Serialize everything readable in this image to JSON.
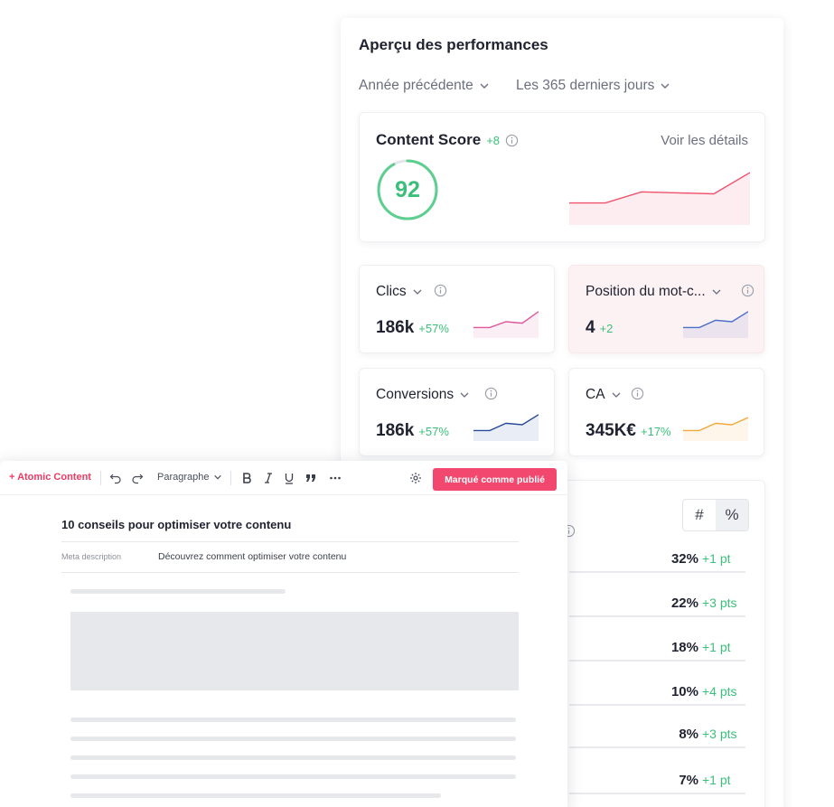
{
  "performance": {
    "title": "Aperçu des performances",
    "period_compare": "Année précédente",
    "period_range": "Les 365 derniers jours",
    "content_score": {
      "label": "Content Score",
      "delta": "+8",
      "value": "92",
      "ring_fraction": 0.92,
      "details_link": "Voir les détails",
      "trend": [
        0.4,
        0.4,
        0.62,
        0.6,
        0.58,
        1.0
      ],
      "color": "#f0526b"
    },
    "metrics": {
      "clics": {
        "label": "Clics",
        "value": "186k",
        "delta": "+57%",
        "trend": [
          0.3,
          0.3,
          0.5,
          0.45,
          0.85
        ],
        "color": "#e0579a"
      },
      "position": {
        "label": "Position du mot-c...",
        "value": "4",
        "delta": "+2",
        "trend": [
          0.3,
          0.3,
          0.55,
          0.5,
          0.85
        ],
        "color": "#4a6fc9"
      },
      "conversions": {
        "label": "Conversions",
        "value": "186k",
        "delta": "+57%",
        "trend": [
          0.3,
          0.3,
          0.55,
          0.5,
          0.85
        ],
        "color": "#2a4a9a"
      },
      "ca": {
        "label": "CA",
        "value": "345K€",
        "delta": "+17%",
        "trend": [
          0.3,
          0.3,
          0.55,
          0.5,
          0.75
        ],
        "color": "#f2a93b"
      }
    },
    "toggle": {
      "hash": "#",
      "percent": "%"
    },
    "rows": [
      {
        "pct": "32%",
        "pts": "+1 pt"
      },
      {
        "pct": "22%",
        "pts": "+3 pts"
      },
      {
        "pct": "18%",
        "pts": "+1 pt"
      },
      {
        "pct": "10%",
        "pts": "+4 pts"
      },
      {
        "pct": "8%",
        "pts": "+3 pts"
      },
      {
        "pct": "7%",
        "pts": "+1 pt"
      }
    ]
  },
  "editor": {
    "brand": "+ Atomic Content",
    "paragraph_style": "Paragraphe",
    "publish_label": "Marqué comme publié",
    "doc_title": "10 conseils pour optimiser votre contenu",
    "meta_label": "Meta description",
    "meta_value": "Découvrez comment optimiser votre contenu"
  },
  "colors": {
    "accent": "#f2486f",
    "positive": "#3bbf7a"
  }
}
